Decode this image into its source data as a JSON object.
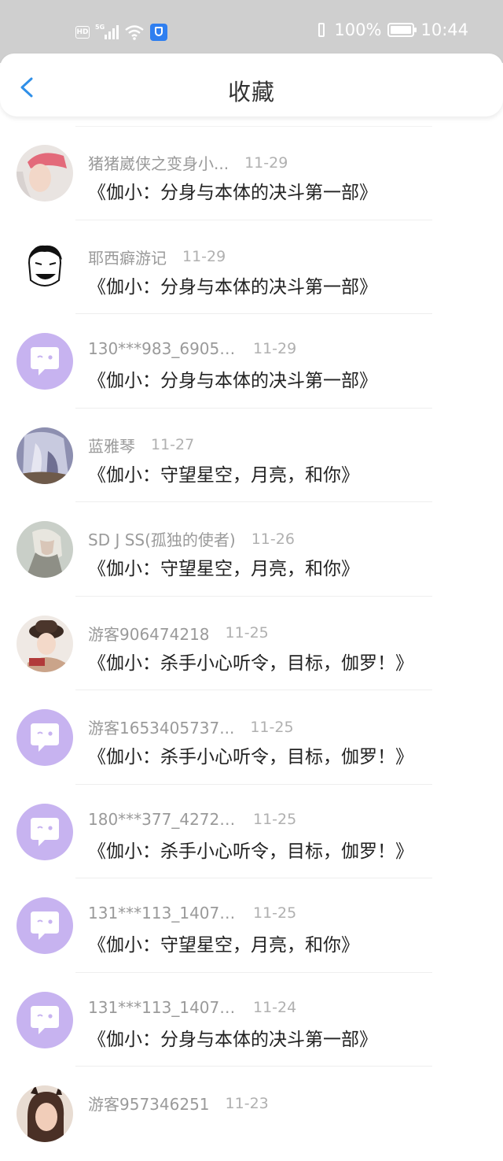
{
  "status_bar": {
    "left_icons": [
      "hd-icon",
      "5g-signal-icon",
      "wifi-icon",
      "security-shield-icon"
    ],
    "hd_label": "HD",
    "network": "5G",
    "battery_percent": "100%",
    "time": "10:44"
  },
  "header": {
    "back_icon": "chevron-left-icon",
    "title": "收藏",
    "accent_color": "#2f8fe8"
  },
  "default_avatar_color": "#c7b3f0",
  "favorites": [
    {
      "user": "猪猪崴侠之变身小...",
      "date": "11-29",
      "title": "《伽小：分身与本体的决斗第一部》",
      "avatar": "photo"
    },
    {
      "user": "耶西癖游记",
      "date": "11-29",
      "title": "《伽小：分身与本体的决斗第一部》",
      "avatar": "meme-face"
    },
    {
      "user": "130***983_69053...",
      "date": "11-29",
      "title": "《伽小：分身与本体的决斗第一部》",
      "avatar": "default"
    },
    {
      "user": "蓝雅琴",
      "date": "11-27",
      "title": "《伽小：守望星空，月亮，和你》",
      "avatar": "photo"
    },
    {
      "user": "SD J SS(孤独的使者)",
      "date": "11-26",
      "title": "《伽小：守望星空，月亮，和你》",
      "avatar": "photo"
    },
    {
      "user": "游客906474218",
      "date": "11-25",
      "title": "《伽小：杀手小心听令，目标，伽罗！》",
      "avatar": "photo"
    },
    {
      "user": "游客1653405737...",
      "date": "11-25",
      "title": "《伽小：杀手小心听令，目标，伽罗！》",
      "avatar": "default"
    },
    {
      "user": "180***377_42725...",
      "date": "11-25",
      "title": "《伽小：杀手小心听令，目标，伽罗！》",
      "avatar": "default"
    },
    {
      "user": "131***113_14077...",
      "date": "11-25",
      "title": "《伽小：守望星空，月亮，和你》",
      "avatar": "default"
    },
    {
      "user": "131***113_14077...",
      "date": "11-24",
      "title": "《伽小：分身与本体的决斗第一部》",
      "avatar": "default"
    },
    {
      "user": "游客957346251",
      "date": "11-23",
      "title": "",
      "avatar": "photo"
    }
  ]
}
